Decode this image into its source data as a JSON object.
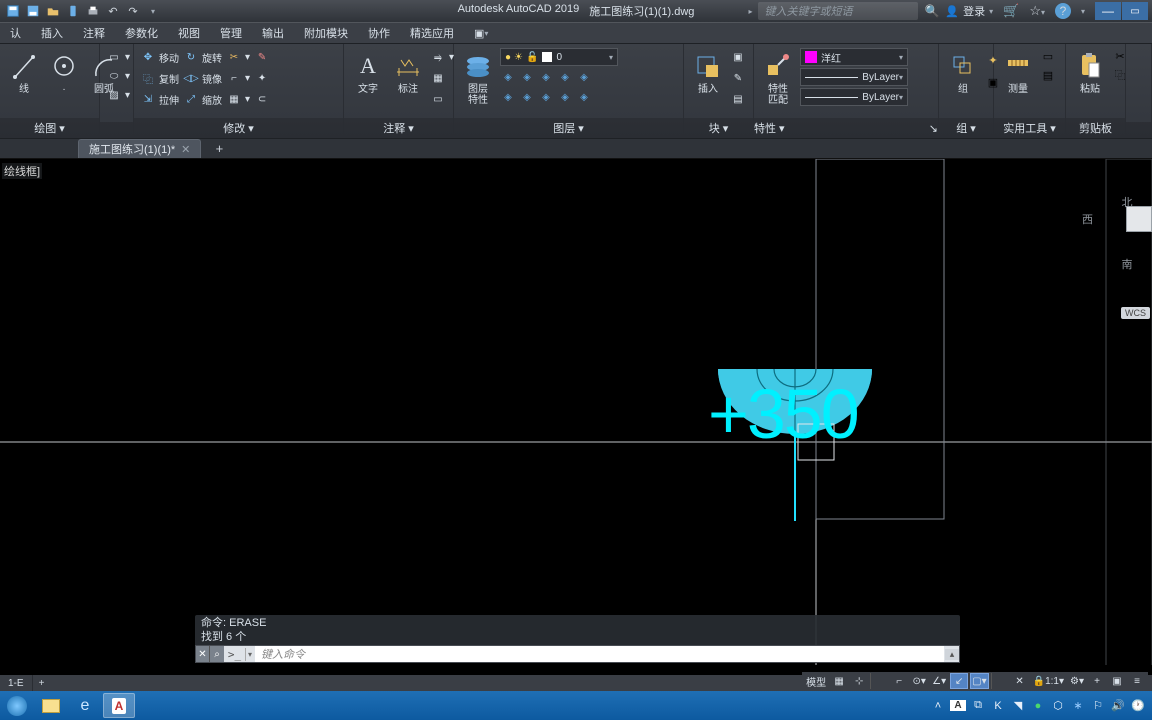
{
  "app": {
    "name": "Autodesk AutoCAD 2019",
    "doc": "施工图练习(1)(1).dwg"
  },
  "qat_icons": [
    "floppy",
    "floppy2",
    "export",
    "mobile",
    "print",
    "undo",
    "redo"
  ],
  "title_search_placeholder": "键入关键字或短语",
  "login": "登录",
  "menus": [
    "认",
    "插入",
    "注释",
    "参数化",
    "视图",
    "管理",
    "输出",
    "附加模块",
    "协作",
    "精选应用"
  ],
  "ribbon": {
    "draw": {
      "title": "绘图 ▾",
      "line": "线",
      "arc": "圆弧"
    },
    "modify": {
      "title": "修改 ▾",
      "move": "移动",
      "rotate": "旋转",
      "copy": "复制",
      "mirror": "镜像",
      "stretch": "拉伸",
      "scale": "缩放"
    },
    "annot": {
      "title": "注释 ▾",
      "text": "文字",
      "dim": "标注"
    },
    "layer": {
      "title": "图层 ▾",
      "props": "图层\n特性",
      "current": "0"
    },
    "block": {
      "title": "块 ▾",
      "insert": "插入"
    },
    "props": {
      "title": "特性 ▾",
      "match": "特性\n匹配",
      "color": "洋红",
      "bylayer1": "ByLayer",
      "bylayer2": "ByLayer"
    },
    "group": {
      "title": "组 ▾",
      "label": "组"
    },
    "util": {
      "title": "实用工具 ▾",
      "label": "测量"
    },
    "clip": {
      "title": "剪贴板",
      "label": "粘贴"
    }
  },
  "filetab": "施工图练习(1)(1)*",
  "visual_style": "绘线框]",
  "drawing": {
    "elev_text": "+350"
  },
  "viewcube": {
    "north": "北",
    "west": "西",
    "south": "南",
    "wcs": "WCS"
  },
  "cmd": {
    "hist1": "命令:  ERASE",
    "hist2": "找到 6 个",
    "prompt": ">_",
    "placeholder": "键入命令"
  },
  "layout": {
    "tab1": "1-E",
    "add": "+"
  },
  "status": {
    "model": "模型",
    "scale": "1:1"
  },
  "taskbar": {
    "tray_icons": [
      "⌃",
      "A",
      "⧉",
      "K",
      "⎚",
      "◉",
      "🔒",
      "🕪",
      "🕑"
    ]
  }
}
